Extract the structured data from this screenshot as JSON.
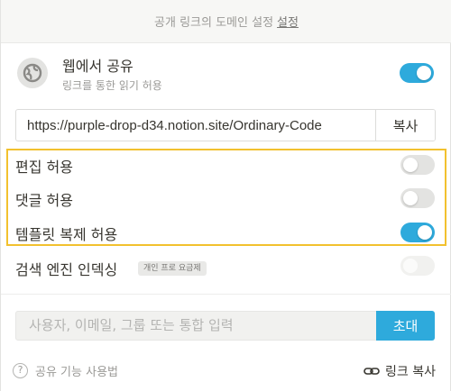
{
  "banner": {
    "text": "공개 링크의 도메인 설정",
    "link": "설정"
  },
  "share": {
    "title": "웹에서 공유",
    "subtitle": "링크를 통한 읽기 허용",
    "enabled": true
  },
  "url": {
    "value": "https://purple-drop-d34.notion.site/Ordinary-Code",
    "copy_label": "복사"
  },
  "options": [
    {
      "label": "편집 허용",
      "enabled": false
    },
    {
      "label": "댓글 허용",
      "enabled": false
    },
    {
      "label": "템플릿 복제 허용",
      "enabled": true
    }
  ],
  "search_index": {
    "label": "검색 엔진 인덱싱",
    "badge": "개인 프로 요금제",
    "enabled": false
  },
  "invite": {
    "placeholder": "사용자, 이메일, 그룹 또는 통합 입력",
    "button": "초대"
  },
  "footer": {
    "help": "공유 기능 사용법",
    "copy_link": "링크 복사"
  },
  "colors": {
    "accent": "#2eaadc",
    "highlight": "#f2c12e"
  },
  "icons": {
    "globe": "globe-icon",
    "help": "help-circle-icon",
    "link": "link-icon"
  }
}
